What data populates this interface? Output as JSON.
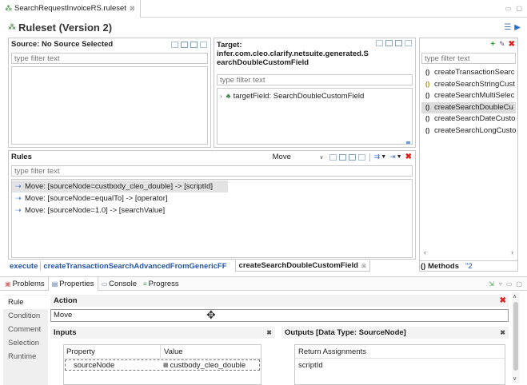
{
  "editor_tab": {
    "title": "SearchRequestInvoiceRS.ruleset",
    "close": "⊠"
  },
  "window_controls": {
    "minimize": "▭",
    "maximize": "▢"
  },
  "ruleset_title": "Ruleset (Version 2)",
  "source": {
    "title": "Source: No Source Selected",
    "filter_placeholder": "type filter text"
  },
  "target": {
    "title_line1": "Target:",
    "title_line2": "infer.com.cleo.clarify.netsuite.generated.S",
    "title_line3": "earchDoubleCustomField",
    "filter_placeholder": "type filter text",
    "tree_item": "targetField: SearchDoubleCustomField"
  },
  "methods": {
    "filter_placeholder": "type filter text",
    "items": [
      {
        "icon": "()",
        "label": "createTransactionSearc"
      },
      {
        "icon": "()",
        "label": "createSearchStringCust"
      },
      {
        "icon": "()",
        "label": "createSearchMultiSelec"
      },
      {
        "icon": "()",
        "label": "createSearchDoubleCu"
      },
      {
        "icon": "()",
        "label": "createSearchDateCusto"
      },
      {
        "icon": "()",
        "label": "createSearchLongCusto"
      }
    ],
    "tab_label": "() Methods",
    "tab_extra": "\"2"
  },
  "rules": {
    "title": "Rules",
    "action_select": "Move",
    "filter_placeholder": "type filter text",
    "items": [
      "Move: [sourceNode=custbody_cleo_double] -> [scriptId]",
      "Move: [sourceNode=equalTo] -> [operator]",
      "Move: [sourceNode=1.0] -> [searchValue]"
    ]
  },
  "breadcrumb": {
    "execute": "execute",
    "step1": "createTransactionSearchAdvancedFromGenericFF",
    "step2": "createSearchDoubleCustomField",
    "close": "⊠"
  },
  "bottom_tabs": {
    "problems": "Problems",
    "properties": "Properties",
    "console": "Console",
    "progress": "Progress"
  },
  "props_side": [
    "Rule",
    "Condition",
    "Comment",
    "Selection",
    "Runtime"
  ],
  "action": {
    "label": "Action",
    "value": "Move"
  },
  "inputs": {
    "title": "Inputs",
    "col_property": "Property",
    "col_value": "Value",
    "row_property": "sourceNode",
    "row_value": "custbody_cleo_double"
  },
  "outputs": {
    "title": "Outputs [Data Type: SourceNode]",
    "col_return": "Return Assignments",
    "row_value": "scriptId"
  }
}
